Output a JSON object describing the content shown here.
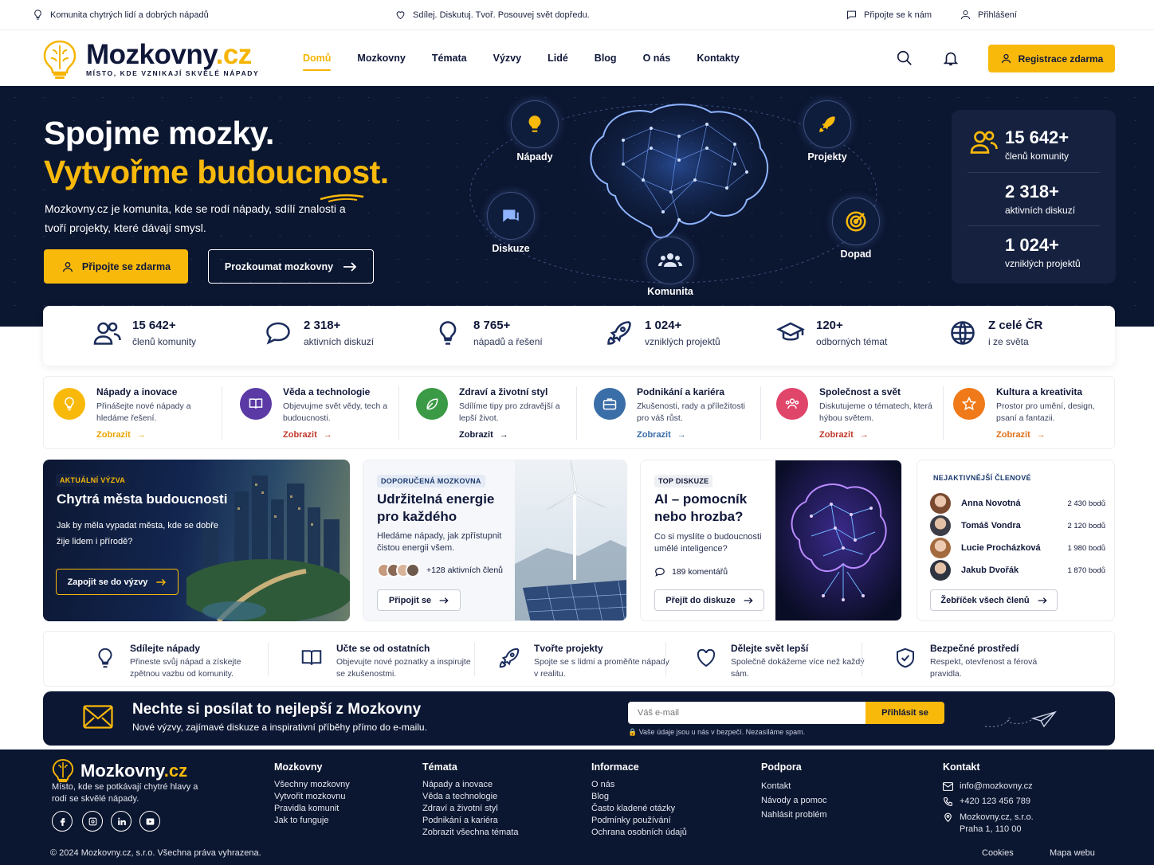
{
  "topbar": {
    "left": "Komunita chytrých lidí a dobrých nápadů",
    "center": "Sdílej. Diskutuj. Tvoř. Posouvej svět dopředu.",
    "join": "Připojte se k nám",
    "login": "Přihlášení"
  },
  "brand": {
    "name_main": "Mozkovny",
    "name_tld": ".cz",
    "tagline": "MÍSTO, KDE VZNIKAJÍ SKVĚLÉ NÁPADY"
  },
  "nav": {
    "items": [
      "Domů",
      "Mozkovny",
      "Témata",
      "Výzvy",
      "Lidé",
      "Blog",
      "O nás",
      "Kontakty"
    ],
    "active": "Domů",
    "register": "Registrace zdarma"
  },
  "hero": {
    "line1": "Spojme mozky.",
    "line2": "Vytvořme budoucnost.",
    "lead": "Mozkovny.cz je komunita, kde se rodí nápady, sdílí znalosti a tvoří projekty, které dávají smysl.",
    "cta_primary": "Připojte se zdarma",
    "cta_secondary": "Prozkoumat mozkovny",
    "nodes": {
      "ideas": "Nápady",
      "projects": "Projekty",
      "discussion": "Diskuze",
      "impact": "Dopad",
      "community": "Komunita"
    },
    "stats": [
      {
        "value": "15 642+",
        "label": "členů komunity"
      },
      {
        "value": "2 318+",
        "label": "aktivních diskuzí"
      },
      {
        "value": "1 024+",
        "label": "vzniklých projektů"
      }
    ]
  },
  "stats": [
    {
      "value": "15 642+",
      "label": "členů komunity",
      "icon": "users-icon"
    },
    {
      "value": "2 318+",
      "label": "aktivních diskuzí",
      "icon": "chat-icon"
    },
    {
      "value": "8 765+",
      "label": "nápadů a řešení",
      "icon": "bulb-icon"
    },
    {
      "value": "1 024+",
      "label": "vzniklých projektů",
      "icon": "rocket-icon"
    },
    {
      "value": "120+",
      "label": "odborných témat",
      "icon": "graduation-cap-icon"
    },
    {
      "value": "Z celé ČR",
      "label": "i ze světa",
      "icon": "globe-icon"
    }
  ],
  "categories": [
    {
      "title": "Nápady a inovace",
      "desc": "Přinášejte nové nápady a hledáme řešení.",
      "link": "Zobrazit",
      "color": "#f8b90b",
      "link_color": "#e8a400"
    },
    {
      "title": "Věda a technologie",
      "desc": "Objevujme svět vědy, tech a budoucnosti.",
      "link": "Zobrazit",
      "color": "#5b3aa6",
      "link_color": "#c0392b"
    },
    {
      "title": "Zdraví a životní styl",
      "desc": "Sdílíme tipy pro zdravější a lepší život.",
      "link": "Zobrazit",
      "color": "#3a9a45",
      "link_color": "#10183a"
    },
    {
      "title": "Podnikání a kariéra",
      "desc": "Zkušenosti, rady a příležitosti pro váš růst.",
      "link": "Zobrazit",
      "color": "#3a6ea8",
      "link_color": "#3a6ea8"
    },
    {
      "title": "Společnost a svět",
      "desc": "Diskutujeme o tématech, která hýbou světem.",
      "link": "Zobrazit",
      "color": "#e0456a",
      "link_color": "#c0392b"
    },
    {
      "title": "Kultura a kreativita",
      "desc": "Prostor pro umění, design, psaní a fantazii.",
      "link": "Zobrazit",
      "color": "#f07a1a",
      "link_color": "#e0701a"
    }
  ],
  "challenge": {
    "badge": "AKTUÁLNÍ VÝZVA",
    "title": "Chytrá města budoucnosti",
    "desc": "Jak by měla vypadat města, kde se dobře žije lidem i přírodě?",
    "button": "Zapojit se do výzvy"
  },
  "recommended": {
    "badge": "DOPORUČENÁ MOZKOVNA",
    "title": "Udržitelná energie pro každého",
    "desc": "Hledáme nápady, jak zpřístupnit čistou energii všem.",
    "members": "+128 aktivních členů",
    "button": "Připojit se"
  },
  "discussion": {
    "badge": "TOP DISKUZE",
    "title": "AI – pomocník nebo hrozba?",
    "desc": "Co si myslíte o budoucnosti umělé inteligence?",
    "comments": "189 komentářů",
    "button": "Přejít do diskuze"
  },
  "top_members": {
    "badge": "NEJAKTIVNĚJŠÍ ČLENOVÉ",
    "members": [
      {
        "name": "Anna Novotná",
        "points": "2 430 bodů"
      },
      {
        "name": "Tomáš Vondra",
        "points": "2 120 bodů"
      },
      {
        "name": "Lucie Procházková",
        "points": "1 980 bodů"
      },
      {
        "name": "Jakub Dvořák",
        "points": "1 870 bodů"
      }
    ],
    "button": "Žebříček všech členů"
  },
  "features": [
    {
      "title": "Sdílejte nápady",
      "desc": "Přineste svůj nápad a získejte zpětnou vazbu od komunity.",
      "icon": "bulb-icon"
    },
    {
      "title": "Učte se od ostatních",
      "desc": "Objevujte nové poznatky a inspirujte se zkušenostmi.",
      "icon": "book-icon"
    },
    {
      "title": "Tvořte projekty",
      "desc": "Spojte se s lidmi a proměňte nápady v realitu.",
      "icon": "rocket-icon"
    },
    {
      "title": "Dělejte svět lepší",
      "desc": "Společně dokážeme více než každý sám.",
      "icon": "heart-icon"
    },
    {
      "title": "Bezpečné prostředí",
      "desc": "Respekt, otevřenost a férová pravidla.",
      "icon": "shield-icon"
    }
  ],
  "newsletter": {
    "title": "Nechte si posílat to nejlepší z Mozkovny",
    "subtitle": "Nové výzvy, zajímavé diskuze a inspirativní příběhy přímo do e-mailu.",
    "placeholder": "Váš e-mail",
    "button": "Přihlásit se",
    "privacy": "Vaše údaje jsou u nás v bezpečí. Nezasíláme spam."
  },
  "footer": {
    "brand_main": "Mozkovny",
    "brand_tld": ".cz",
    "about": "Místo, kde se potkávají chytré hlavy a rodí se skvělé nápady.",
    "columns": [
      {
        "title": "Mozkovny",
        "links": [
          "Všechny mozkovny",
          "Vytvořit mozkovnu",
          "Pravidla komunit",
          "Jak to funguje"
        ]
      },
      {
        "title": "Témata",
        "links": [
          "Nápady a inovace",
          "Věda a technologie",
          "Zdraví a životní styl",
          "Podnikání a kariéra",
          "Zobrazit všechna témata"
        ]
      },
      {
        "title": "Informace",
        "links": [
          "O nás",
          "Blog",
          "Často kladené otázky",
          "Podmínky používání",
          "Ochrana osobních údajů"
        ]
      },
      {
        "title": "Podpora",
        "links": [
          "Kontakt",
          "Návody a pomoc",
          "Nahlásit problém"
        ]
      }
    ],
    "contact": {
      "title": "Kontakt",
      "email": "info@mozkovny.cz",
      "phone": "+420 123 456 789",
      "address1": "Mozkovny.cz, s.r.o.",
      "address2": "Praha 1, 110 00"
    },
    "copyright": "© 2024 Mozkovny.cz, s.r.o. Všechna práva vyhrazena.",
    "cookies": "Cookies",
    "sitemap": "Mapa webu"
  }
}
